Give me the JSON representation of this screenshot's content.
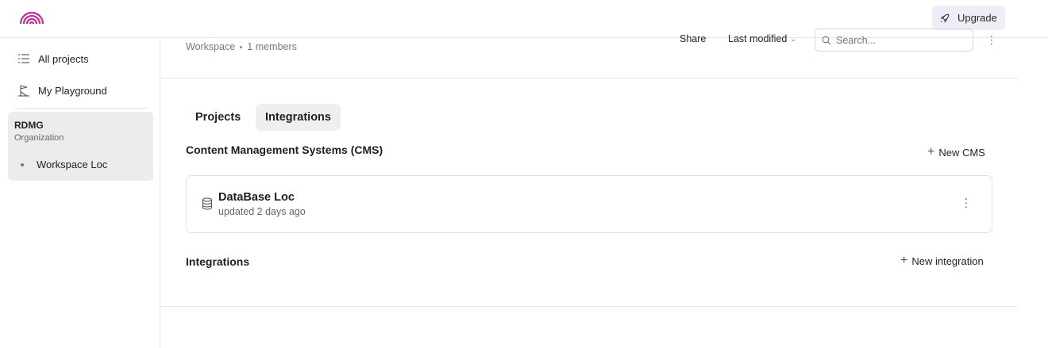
{
  "topbar": {
    "upgrade_label": "Upgrade",
    "logo_icon": "rainbow-logo-icon",
    "upgrade_icon": "rocket-icon",
    "accent": "#c42e8f"
  },
  "sidebar": {
    "items": [
      {
        "label": "All projects",
        "icon": "list-icon"
      },
      {
        "label": "My Playground",
        "icon": "playground-icon"
      }
    ],
    "org": {
      "name": "RDMG",
      "type": "Organization",
      "workspace": "Workspace Loc"
    }
  },
  "header": {
    "ws_type": "Workspace",
    "members": "1 members",
    "share_label": "Share",
    "sort_label": "Last modified",
    "search_placeholder": "Search..."
  },
  "tabs": [
    {
      "label": "Projects",
      "active": false
    },
    {
      "label": "Integrations",
      "active": true
    }
  ],
  "cms_section": {
    "title": "Content Management Systems (CMS)",
    "new_label": "New CMS",
    "items": [
      {
        "name": "DataBase Loc",
        "updated": "updated 2 days ago",
        "icon": "database-icon"
      }
    ]
  },
  "integrations_section": {
    "title": "Integrations",
    "new_label": "New integration"
  }
}
